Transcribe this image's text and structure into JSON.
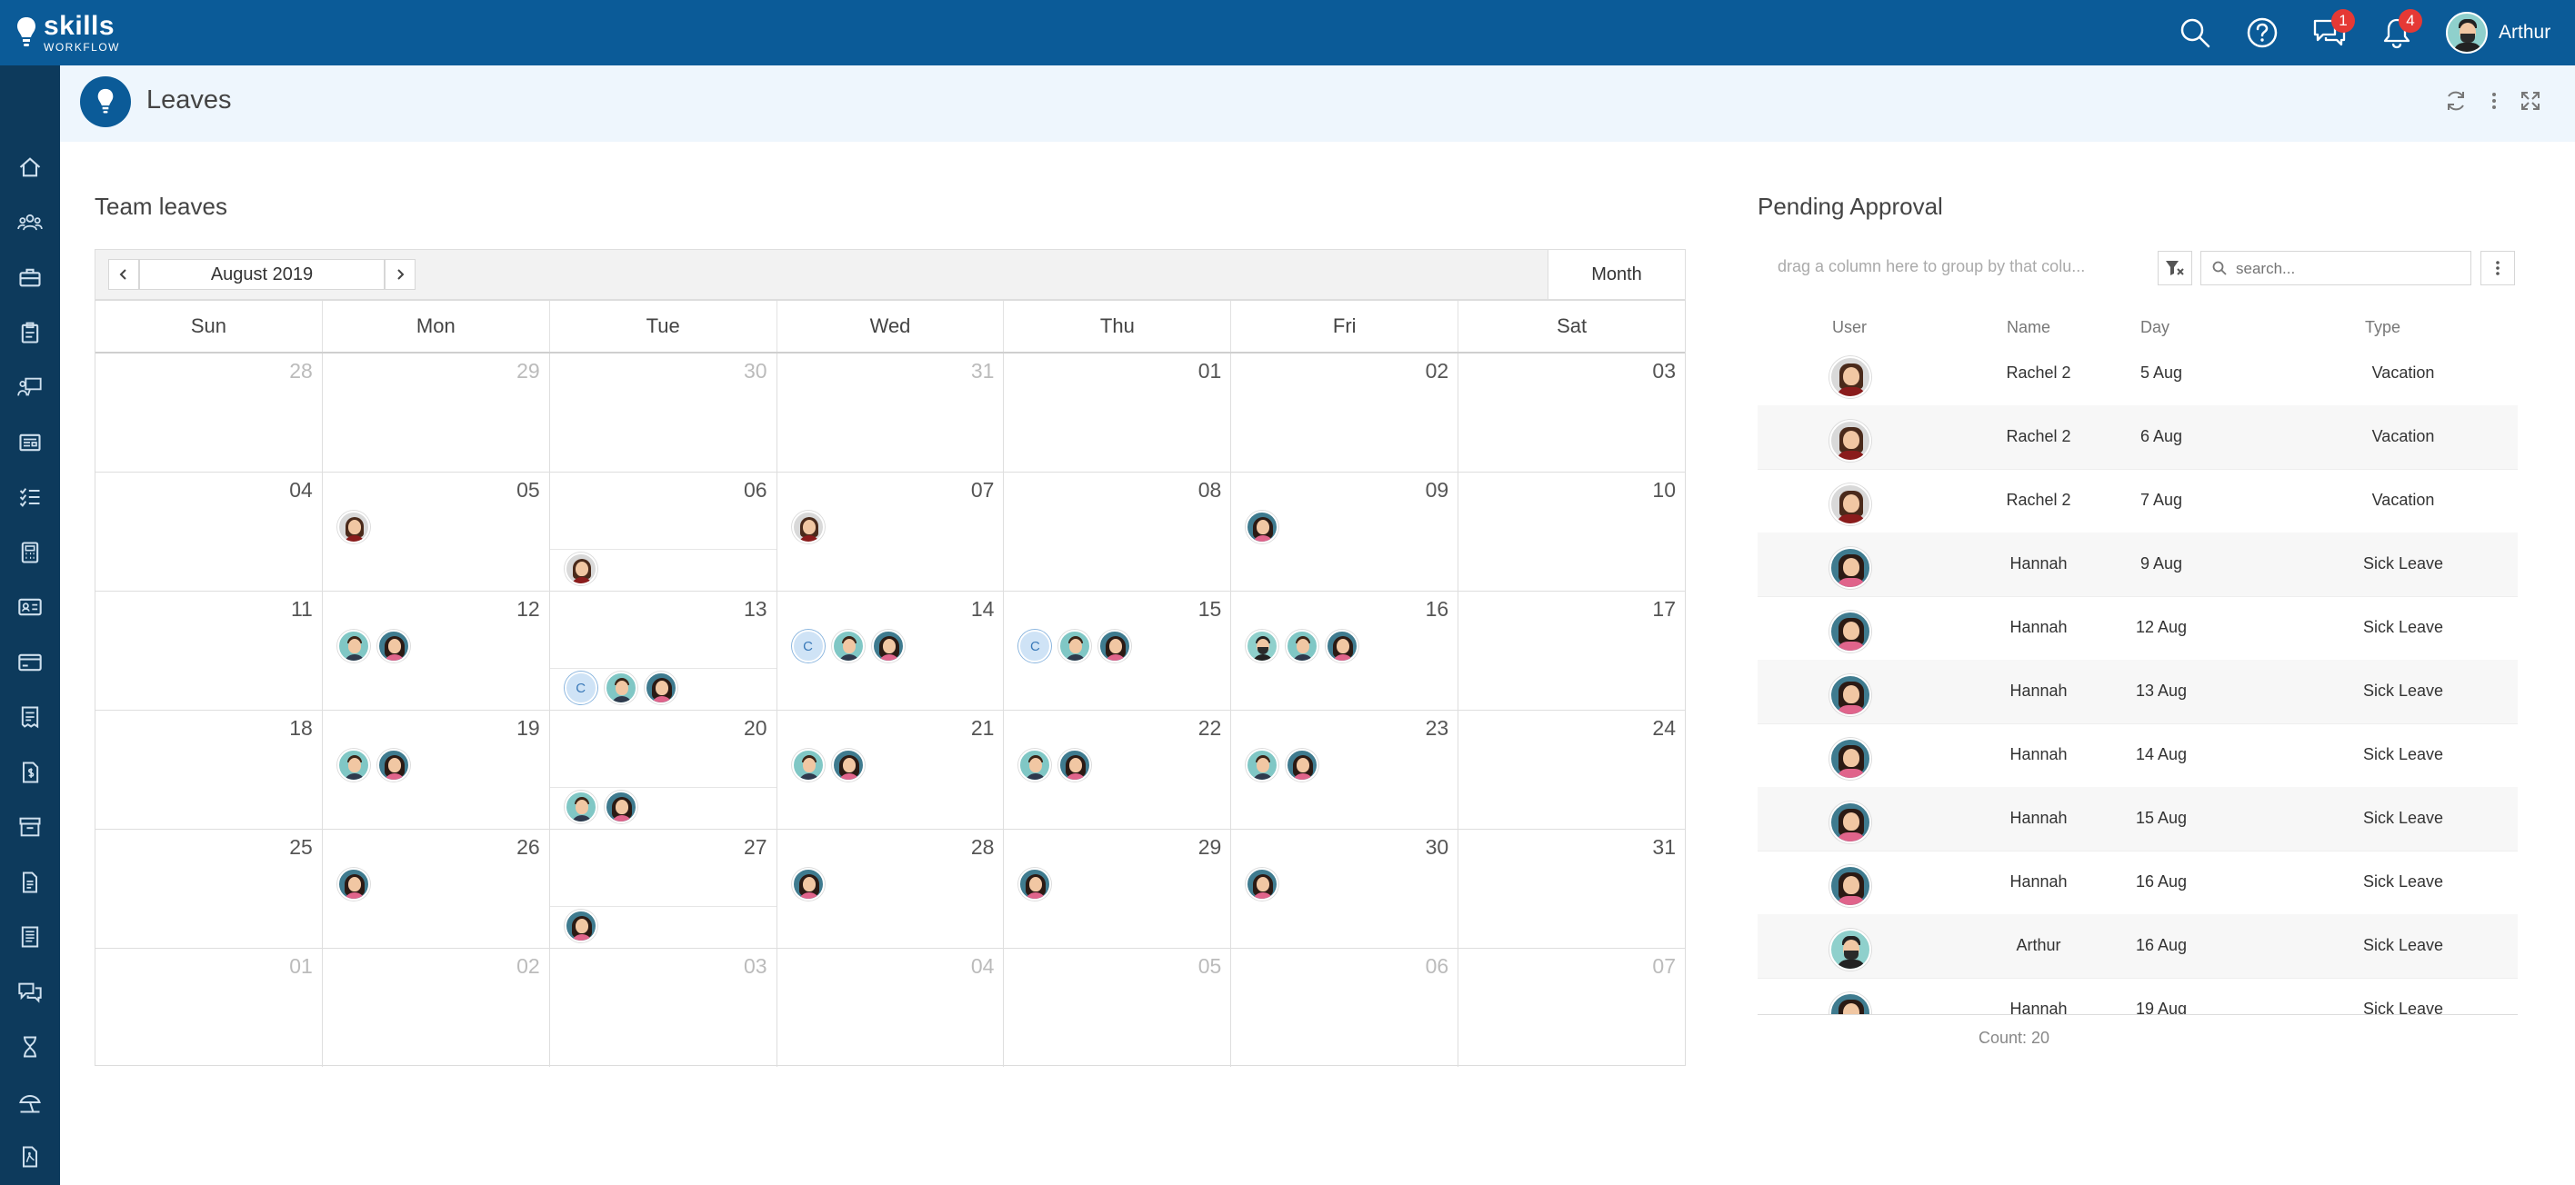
{
  "app": {
    "logo_main": "skills",
    "logo_sub": "WORKFLOW",
    "user_name": "Arthur"
  },
  "topbar": {
    "messages_badge": "1",
    "notifications_badge": "4"
  },
  "sidebar": {
    "items": [
      "home-icon",
      "team-icon",
      "briefcase-icon",
      "clipboard-icon",
      "presentation-icon",
      "newspaper-icon",
      "checklist-icon",
      "calculator-icon",
      "id-card-icon",
      "card-icon",
      "invoice-icon",
      "dollar-doc-icon",
      "archive-icon",
      "document-icon",
      "list-doc-icon",
      "chat-icon",
      "hourglass-icon",
      "beach-icon",
      "pdf-icon"
    ]
  },
  "page": {
    "title": "Leaves"
  },
  "team_leaves": {
    "title": "Team leaves",
    "current_month": "August 2019",
    "view_button": "Month",
    "day_names": [
      "Sun",
      "Mon",
      "Tue",
      "Wed",
      "Thu",
      "Fri",
      "Sat"
    ],
    "weeks": [
      [
        {
          "d": "28",
          "o": true
        },
        {
          "d": "29",
          "o": true
        },
        {
          "d": "30",
          "o": true
        },
        {
          "d": "31",
          "o": true
        },
        {
          "d": "01"
        },
        {
          "d": "02"
        },
        {
          "d": "03"
        }
      ],
      [
        {
          "d": "04"
        },
        {
          "d": "05",
          "r1": [
            "rachel"
          ]
        },
        {
          "d": "06",
          "r2": [
            "rachel"
          ]
        },
        {
          "d": "07",
          "r1": [
            "rachel"
          ]
        },
        {
          "d": "08"
        },
        {
          "d": "09",
          "r1": [
            "hannah"
          ]
        },
        {
          "d": "10"
        }
      ],
      [
        {
          "d": "11"
        },
        {
          "d": "12",
          "r1": [
            "man",
            "hannah"
          ]
        },
        {
          "d": "13",
          "r2": [
            "C",
            "man",
            "hannah"
          ]
        },
        {
          "d": "14",
          "r1": [
            "C",
            "man",
            "hannah"
          ]
        },
        {
          "d": "15",
          "r1": [
            "C",
            "man",
            "hannah"
          ]
        },
        {
          "d": "16",
          "r1": [
            "arthur",
            "man",
            "hannah"
          ]
        },
        {
          "d": "17"
        }
      ],
      [
        {
          "d": "18"
        },
        {
          "d": "19",
          "r1": [
            "man",
            "hannah"
          ]
        },
        {
          "d": "20",
          "r2": [
            "man",
            "hannah"
          ]
        },
        {
          "d": "21",
          "r1": [
            "man",
            "hannah"
          ]
        },
        {
          "d": "22",
          "r1": [
            "man",
            "hannah"
          ]
        },
        {
          "d": "23",
          "r1": [
            "man",
            "hannah"
          ]
        },
        {
          "d": "24"
        }
      ],
      [
        {
          "d": "25"
        },
        {
          "d": "26",
          "r1": [
            "hannah"
          ]
        },
        {
          "d": "27",
          "r2": [
            "hannah"
          ]
        },
        {
          "d": "28",
          "r1": [
            "hannah"
          ]
        },
        {
          "d": "29",
          "r1": [
            "hannah"
          ]
        },
        {
          "d": "30",
          "r1": [
            "hannah"
          ]
        },
        {
          "d": "31"
        }
      ],
      [
        {
          "d": "01",
          "o": true
        },
        {
          "d": "02",
          "o": true
        },
        {
          "d": "03",
          "o": true
        },
        {
          "d": "04",
          "o": true
        },
        {
          "d": "05",
          "o": true
        },
        {
          "d": "06",
          "o": true
        },
        {
          "d": "07",
          "o": true
        }
      ]
    ]
  },
  "pending": {
    "title": "Pending Approval",
    "group_hint": "drag a column here to group by that colu...",
    "search_placeholder": "search...",
    "columns": {
      "user": "User",
      "name": "Name",
      "day": "Day",
      "type": "Type"
    },
    "rows": [
      {
        "avatar": "rachel",
        "name": "Rachel 2",
        "day": "5 Aug",
        "type": "Vacation"
      },
      {
        "avatar": "rachel",
        "name": "Rachel 2",
        "day": "6 Aug",
        "type": "Vacation"
      },
      {
        "avatar": "rachel",
        "name": "Rachel 2",
        "day": "7 Aug",
        "type": "Vacation"
      },
      {
        "avatar": "hannah",
        "name": "Hannah",
        "day": "9 Aug",
        "type": "Sick Leave"
      },
      {
        "avatar": "hannah",
        "name": "Hannah",
        "day": "12 Aug",
        "type": "Sick Leave"
      },
      {
        "avatar": "hannah",
        "name": "Hannah",
        "day": "13 Aug",
        "type": "Sick Leave"
      },
      {
        "avatar": "hannah",
        "name": "Hannah",
        "day": "14 Aug",
        "type": "Sick Leave"
      },
      {
        "avatar": "hannah",
        "name": "Hannah",
        "day": "15 Aug",
        "type": "Sick Leave"
      },
      {
        "avatar": "hannah",
        "name": "Hannah",
        "day": "16 Aug",
        "type": "Sick Leave"
      },
      {
        "avatar": "arthur",
        "name": "Arthur",
        "day": "16 Aug",
        "type": "Sick Leave"
      },
      {
        "avatar": "hannah",
        "name": "Hannah",
        "day": "19 Aug",
        "type": "Sick Leave"
      }
    ],
    "count": "Count: 20"
  }
}
